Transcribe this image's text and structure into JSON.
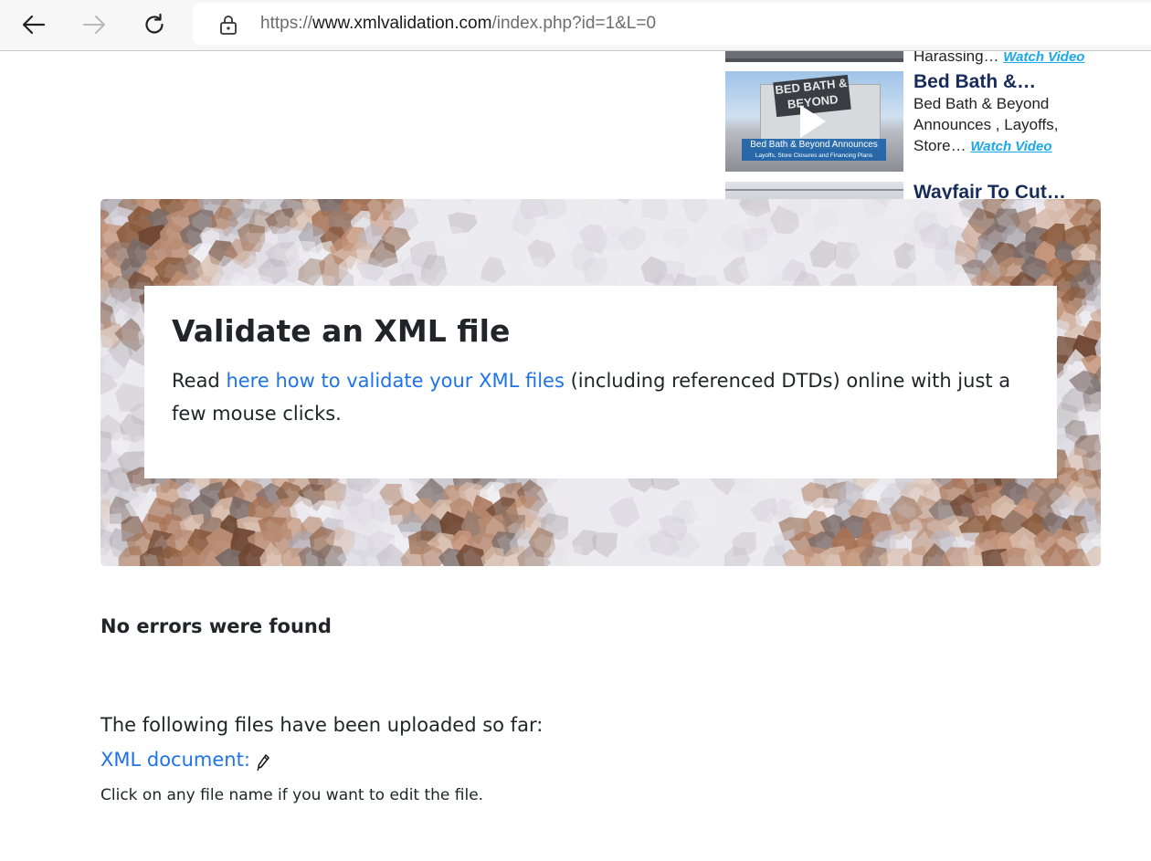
{
  "browser": {
    "url_scheme": "https://",
    "url_host": "www.xmlvalidation.com",
    "url_path": "/index.php?id=1&L=0",
    "icons": [
      "back-arrow-icon",
      "forward-arrow-icon",
      "reload-icon",
      "lock-icon"
    ]
  },
  "ads": {
    "item1_caption": "Harassing…",
    "item1_watch": "Watch Video",
    "item2_title": "Bed Bath &…",
    "item2_line1": "Bed Bath & Beyond",
    "item2_line2": "Announces , Layoffs,",
    "item2_line3": "Store…",
    "item2_watch": "Watch Video",
    "item2_thumb_sign": "BED BATH & BEYOND",
    "item2_thumb_banner": "Bed Bath & Beyond Announces",
    "item2_thumb_subbanner": "Layoffs, Store Closures and Financing Plans",
    "item3_title": "Wayfair To Cut…",
    "play_icon": "play-icon"
  },
  "hero": {
    "title": "Validate an XML file",
    "text_before": "Read ",
    "link": "here how to validate your XML files",
    "text_after": " (including referenced DTDs) online with just a few mouse clicks."
  },
  "result": {
    "message": "No errors were found"
  },
  "files": {
    "intro": "The following files have been uploaded so far:",
    "xml_link": "XML document:",
    "edit_icon": "pencil-icon",
    "hint": "Click on any file name if you want to edit the file."
  },
  "colors": {
    "link": "#1e73e8",
    "ad_title": "#172c5a",
    "watch_video": "#19a8ea"
  }
}
